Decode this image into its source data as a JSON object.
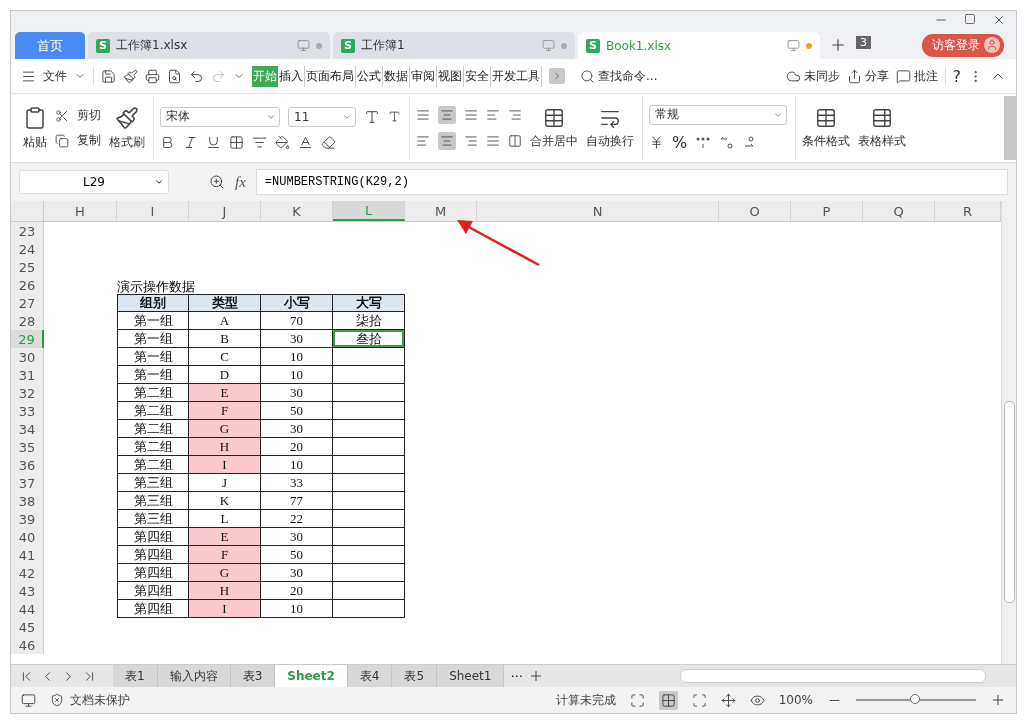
{
  "tabs": [
    {
      "label": "首页",
      "kind": "home",
      "selected": false
    },
    {
      "label": "工作簿1.xlsx",
      "kind": "doc",
      "badge": "S",
      "selected": false,
      "modified": false
    },
    {
      "label": "工作簿1",
      "kind": "doc",
      "badge": "S",
      "selected": false,
      "modified": false
    },
    {
      "label": "Book1.xlsx",
      "kind": "doc",
      "badge": "S",
      "selected": true,
      "modified": true
    }
  ],
  "tab_count": "3",
  "login": "访客登录",
  "menu": {
    "file": "文件",
    "tabs": [
      {
        "label": "开始",
        "selected": true
      },
      {
        "label": "插入",
        "selected": false
      },
      {
        "label": "页面布局",
        "selected": false
      },
      {
        "label": "公式",
        "selected": false
      },
      {
        "label": "数据",
        "selected": false
      },
      {
        "label": "审阅",
        "selected": false
      },
      {
        "label": "视图",
        "selected": false
      },
      {
        "label": "安全",
        "selected": false
      },
      {
        "label": "开发工具",
        "selected": false
      }
    ],
    "search": "查找命令...",
    "sync": "未同步",
    "share": "分享",
    "comment": "批注",
    "help": "?"
  },
  "ribbon": {
    "paste": "粘贴",
    "cut": "剪切",
    "copy": "复制",
    "format_painter": "格式刷",
    "font": "宋体",
    "font_size": "11",
    "merge": "合并居中",
    "wrap": "自动换行",
    "number_format": "常规",
    "percent": "%",
    "conditional_format": "条件格式",
    "table_style": "表格样式"
  },
  "formula_bar": {
    "cell": "L29",
    "fx": "fx",
    "formula": "=NUMBERSTRING(K29,2)"
  },
  "columns": [
    {
      "label": "H",
      "selected": false
    },
    {
      "label": "I",
      "selected": false
    },
    {
      "label": "J",
      "selected": false
    },
    {
      "label": "K",
      "selected": false
    },
    {
      "label": "L",
      "selected": true
    },
    {
      "label": "M",
      "selected": false
    },
    {
      "label": "N",
      "selected": false
    },
    {
      "label": "O",
      "selected": false
    },
    {
      "label": "P",
      "selected": false
    },
    {
      "label": "Q",
      "selected": false
    },
    {
      "label": "R",
      "selected": false
    }
  ],
  "rows": [
    {
      "number": "23",
      "selected": false
    },
    {
      "number": "24",
      "selected": false
    },
    {
      "number": "25",
      "selected": false
    },
    {
      "number": "26",
      "selected": false,
      "caption": "演示操作数据"
    },
    {
      "number": "27",
      "selected": false,
      "kind": "header",
      "cells": [
        {
          "text": "组别"
        },
        {
          "text": "类型"
        },
        {
          "text": "小写"
        },
        {
          "text": "大写"
        }
      ]
    },
    {
      "number": "28",
      "selected": false,
      "kind": "data",
      "cells": [
        {
          "text": "第一组"
        },
        {
          "text": "A",
          "highlighted": false
        },
        {
          "text": "70"
        },
        {
          "text": "柒拾",
          "selected": false
        }
      ]
    },
    {
      "number": "29",
      "selected": true,
      "kind": "data",
      "cells": [
        {
          "text": "第一组"
        },
        {
          "text": "B",
          "highlighted": false
        },
        {
          "text": "30"
        },
        {
          "text": "叁拾",
          "selected": true
        }
      ]
    },
    {
      "number": "30",
      "selected": false,
      "kind": "data",
      "cells": [
        {
          "text": "第一组"
        },
        {
          "text": "C",
          "highlighted": false
        },
        {
          "text": "10"
        },
        {
          "selected": false
        }
      ]
    },
    {
      "number": "31",
      "selected": false,
      "kind": "data",
      "cells": [
        {
          "text": "第一组"
        },
        {
          "text": "D",
          "highlighted": false
        },
        {
          "text": "10"
        },
        {
          "selected": false
        }
      ]
    },
    {
      "number": "32",
      "selected": false,
      "kind": "data",
      "cells": [
        {
          "text": "第二组"
        },
        {
          "text": "E",
          "highlighted": true
        },
        {
          "text": "30"
        },
        {
          "selected": false
        }
      ]
    },
    {
      "number": "33",
      "selected": false,
      "kind": "data",
      "cells": [
        {
          "text": "第二组"
        },
        {
          "text": "F",
          "highlighted": true
        },
        {
          "text": "50"
        },
        {
          "selected": false
        }
      ]
    },
    {
      "number": "34",
      "selected": false,
      "kind": "data",
      "cells": [
        {
          "text": "第二组"
        },
        {
          "text": "G",
          "highlighted": true
        },
        {
          "text": "30"
        },
        {
          "selected": false
        }
      ]
    },
    {
      "number": "35",
      "selected": false,
      "kind": "data",
      "cells": [
        {
          "text": "第二组"
        },
        {
          "text": "H",
          "highlighted": true
        },
        {
          "text": "20"
        },
        {
          "selected": false
        }
      ]
    },
    {
      "number": "36",
      "selected": false,
      "kind": "data",
      "cells": [
        {
          "text": "第二组"
        },
        {
          "text": "I",
          "highlighted": true
        },
        {
          "text": "10"
        },
        {
          "selected": false
        }
      ]
    },
    {
      "number": "37",
      "selected": false,
      "kind": "data",
      "cells": [
        {
          "text": "第三组"
        },
        {
          "text": "J",
          "highlighted": false
        },
        {
          "text": "33"
        },
        {
          "selected": false
        }
      ]
    },
    {
      "number": "38",
      "selected": false,
      "kind": "data",
      "cells": [
        {
          "text": "第三组"
        },
        {
          "text": "K",
          "highlighted": false
        },
        {
          "text": "77"
        },
        {
          "selected": false
        }
      ]
    },
    {
      "number": "39",
      "selected": false,
      "kind": "data",
      "cells": [
        {
          "text": "第三组"
        },
        {
          "text": "L",
          "highlighted": false
        },
        {
          "text": "22"
        },
        {
          "selected": false
        }
      ]
    },
    {
      "number": "40",
      "selected": false,
      "kind": "data",
      "cells": [
        {
          "text": "第四组"
        },
        {
          "text": "E",
          "highlighted": true
        },
        {
          "text": "30"
        },
        {
          "selected": false
        }
      ]
    },
    {
      "number": "41",
      "selected": false,
      "kind": "data",
      "cells": [
        {
          "text": "第四组"
        },
        {
          "text": "F",
          "highlighted": true
        },
        {
          "text": "50"
        },
        {
          "selected": false
        }
      ]
    },
    {
      "number": "42",
      "selected": false,
      "kind": "data",
      "cells": [
        {
          "text": "第四组"
        },
        {
          "text": "G",
          "highlighted": true
        },
        {
          "text": "30"
        },
        {
          "selected": false
        }
      ]
    },
    {
      "number": "43",
      "selected": false,
      "kind": "data",
      "cells": [
        {
          "text": "第四组"
        },
        {
          "text": "H",
          "highlighted": true
        },
        {
          "text": "20"
        },
        {
          "selected": false
        }
      ]
    },
    {
      "number": "44",
      "selected": false,
      "kind": "data",
      "cells": [
        {
          "text": "第四组"
        },
        {
          "text": "I",
          "highlighted": true
        },
        {
          "text": "10"
        },
        {
          "selected": false
        }
      ]
    },
    {
      "number": "45",
      "selected": false
    },
    {
      "number": "46",
      "selected": false
    }
  ],
  "sheets": [
    {
      "label": "表1",
      "selected": false
    },
    {
      "label": "输入内容",
      "selected": false
    },
    {
      "label": "表3",
      "selected": false
    },
    {
      "label": "Sheet2",
      "selected": true
    },
    {
      "label": "表4",
      "selected": false
    },
    {
      "label": "表5",
      "selected": false
    },
    {
      "label": "Sheet1",
      "selected": false
    }
  ],
  "sheets_more": "⋯",
  "status_bar": {
    "protection": "文档未保护",
    "calc": "计算未完成",
    "zoom": "100%",
    "level": 0.5
  }
}
